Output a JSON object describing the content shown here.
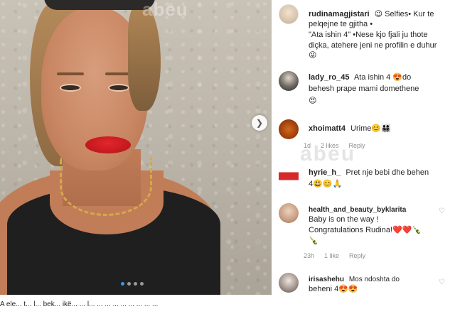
{
  "photo": {
    "watermark": "abeu",
    "next_icon": "chevron-right-icon",
    "carousel": {
      "count": 4,
      "active_index": 0
    }
  },
  "comments": [
    {
      "username": "rudinamagjistari",
      "text_line1": "Selfies• Kur te",
      "text_line2": "pelqejne te gjitha •",
      "text_line3": "\"Ata ishin 4\" •Nese kjo fjali ju thote",
      "text_line4": "diçka, atehere jeni ne profilin e duhur",
      "emoji_lead": "😉",
      "emoji_tail": "😜"
    },
    {
      "username": "lady_ro_45",
      "text_line1": "Ata ishin 4 😍do",
      "text_line2": "behesh prape mami domethene",
      "text_line3": "😍"
    },
    {
      "username": "xhoimatt4",
      "text_line1": "Urime😊👨‍👩‍👧‍👦",
      "time": "1d",
      "likes": "2 likes",
      "reply": "Reply",
      "watermark": "abeu"
    },
    {
      "username": "hyrie_h_",
      "text_line1": "Pret nje bebi dhe behen",
      "text_line2": "4😃😊🙏"
    },
    {
      "username": "health_and_beauty_byklarita",
      "text_line1": "Baby is on the way !",
      "text_line2": "Congratulations Rudina!❤️❤️🍾",
      "text_line3": "🍾",
      "time": "23h",
      "likes": "1 like",
      "reply": "Reply"
    },
    {
      "username": "irisashehu",
      "text_line1": "Mos ndoshta do",
      "text_line2": "beheni 4😍😍"
    }
  ],
  "bottom_caption": "A ele... t... l... bek... ikë... ... l... ... ... ... ... ... ... ... ..."
}
